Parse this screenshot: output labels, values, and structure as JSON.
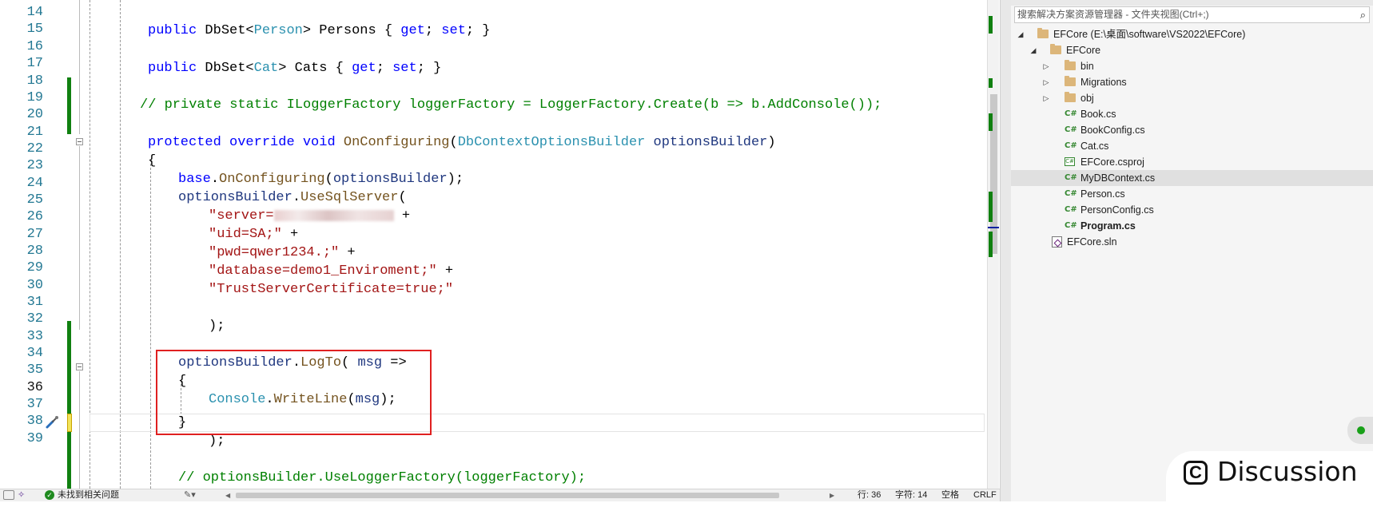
{
  "editor": {
    "line_numbers": [
      "14",
      "15",
      "16",
      "17",
      "18",
      "19",
      "20",
      "21",
      "22",
      "23",
      "24",
      "25",
      "26",
      "27",
      "28",
      "29",
      "30",
      "31",
      "32",
      "33",
      "34",
      "35",
      "36",
      "37",
      "38",
      "39"
    ],
    "current_line": "36",
    "code": {
      "l15": {
        "kw1": "public",
        "t1": " DbSet<",
        "ty1": "Person",
        "t2": "> Persons { ",
        "kw2": "get",
        "t3": "; ",
        "kw3": "set",
        "t4": "; }"
      },
      "l17": {
        "kw1": "public",
        "t1": " DbSet<",
        "ty1": "Cat",
        "t2": "> Cats { ",
        "kw2": "get",
        "t3": "; ",
        "kw3": "set",
        "t4": "; }"
      },
      "l19": "// private static ILoggerFactory loggerFactory = LoggerFactory.Create(b => b.AddConsole());",
      "l21": {
        "kw1": "protected",
        "kw2": "override",
        "kw3": "void",
        "fn": "OnConfiguring",
        "open": "(",
        "ty": "DbContextOptionsBuilder",
        "param": "optionsBuilder",
        "close": ")"
      },
      "l22": "{",
      "l23": {
        "kw": "base",
        "dot": ".",
        "fn": "OnConfiguring",
        "open": "(",
        "arg": "optionsBuilder",
        "close": ");"
      },
      "l24": {
        "obj": "optionsBuilder",
        "dot": ".",
        "fn": "UseSqlServer",
        "open": "("
      },
      "l25": {
        "str": "\"server=",
        "tail": " +"
      },
      "l26": {
        "str": "\"uid=SA;\"",
        "tail": " +"
      },
      "l27": {
        "str": "\"pwd=qwer1234.;\"",
        "tail": " +"
      },
      "l28": {
        "str": "\"database=demo1_Enviroment;\"",
        "tail": " +"
      },
      "l29": {
        "str": "\"TrustServerCertificate=true;\""
      },
      "l31": ");",
      "l33": {
        "obj": "optionsBuilder",
        "dot": ".",
        "fn": "LogTo",
        "open": "( ",
        "param": "msg",
        "arrow": " =>"
      },
      "l34": "{",
      "l35": {
        "ty": "Console",
        "dot": ".",
        "fn": "WriteLine",
        "open": "(",
        "arg": "msg",
        "close": ");"
      },
      "l36": "}",
      "l37": ");",
      "l39": "// optionsBuilder.UseLoggerFactory(loggerFactory);"
    }
  },
  "statusbar": {
    "issues": "未找到相关问题",
    "line": "行: 36",
    "char": "字符: 14",
    "whitespace": "空格",
    "line_ending": "CRLF"
  },
  "solution_explorer": {
    "search_placeholder": "搜索解决方案资源管理器 - 文件夹视图(Ctrl+;)",
    "search_icon": "magnifier-icon",
    "items": [
      {
        "label": "EFCore (E:\\桌面\\software\\VS2022\\EFCore)",
        "icon": "folder-icon",
        "expander": "◢"
      },
      {
        "label": "EFCore",
        "icon": "folder-icon",
        "expander": "◢"
      },
      {
        "label": "bin",
        "icon": "folder-icon",
        "expander": "▷"
      },
      {
        "label": "Migrations",
        "icon": "folder-icon",
        "expander": "▷"
      },
      {
        "label": "obj",
        "icon": "folder-icon",
        "expander": "▷"
      },
      {
        "label": "Book.cs",
        "icon": "csharp-file-icon",
        "icon_text": "C#"
      },
      {
        "label": "BookConfig.cs",
        "icon": "csharp-file-icon",
        "icon_text": "C#"
      },
      {
        "label": "Cat.cs",
        "icon": "csharp-file-icon",
        "icon_text": "C#"
      },
      {
        "label": "EFCore.csproj",
        "icon": "csproj-file-icon",
        "icon_text": "C#"
      },
      {
        "label": "MyDBContext.cs",
        "icon": "csharp-file-icon",
        "icon_text": "C#",
        "selected": true
      },
      {
        "label": "Person.cs",
        "icon": "csharp-file-icon",
        "icon_text": "C#"
      },
      {
        "label": "PersonConfig.cs",
        "icon": "csharp-file-icon",
        "icon_text": "C#"
      },
      {
        "label": "Program.cs",
        "icon": "csharp-file-icon",
        "icon_text": "C#",
        "bold": true
      },
      {
        "label": "EFCore.sln",
        "icon": "solution-file-icon"
      }
    ]
  },
  "overlay": {
    "discussion_icon": "C",
    "discussion_label": "Discussion"
  },
  "colors": {
    "keyword": "#0000ff",
    "type": "#2b91af",
    "method": "#74531f",
    "string": "#a31515",
    "comment": "#008000",
    "parameter": "#1f377f",
    "line_number": "#237893",
    "change_marker": "#108010",
    "highlight_box": "#e02020"
  }
}
